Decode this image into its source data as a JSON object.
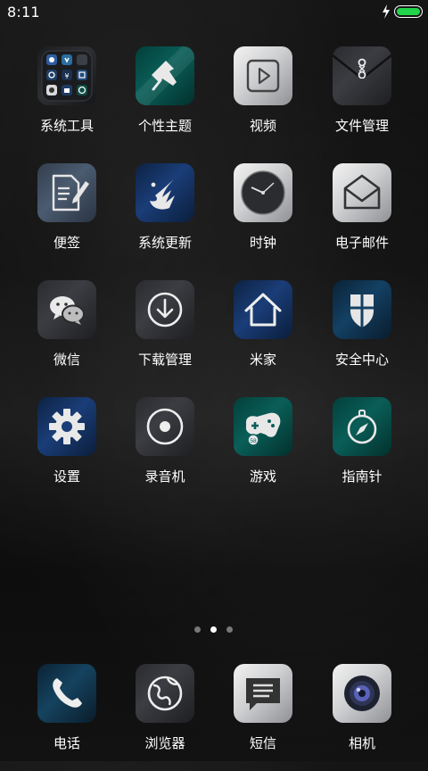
{
  "status_bar": {
    "time": "8:11",
    "battery_color": "#21d44b"
  },
  "apps": [
    {
      "label": "系统工具",
      "icon": "tools-folder-icon"
    },
    {
      "label": "个性主题",
      "icon": "theme-brush-icon"
    },
    {
      "label": "视频",
      "icon": "video-play-icon"
    },
    {
      "label": "文件管理",
      "icon": "file-manager-icon"
    },
    {
      "label": "便签",
      "icon": "notes-icon"
    },
    {
      "label": "系统更新",
      "icon": "system-update-icon"
    },
    {
      "label": "时钟",
      "icon": "clock-icon"
    },
    {
      "label": "电子邮件",
      "icon": "email-icon"
    },
    {
      "label": "微信",
      "icon": "wechat-icon"
    },
    {
      "label": "下载管理",
      "icon": "download-icon"
    },
    {
      "label": "米家",
      "icon": "home-icon"
    },
    {
      "label": "安全中心",
      "icon": "security-shield-icon"
    },
    {
      "label": "设置",
      "icon": "settings-gear-icon"
    },
    {
      "label": "录音机",
      "icon": "recorder-icon"
    },
    {
      "label": "游戏",
      "icon": "gamepad-icon"
    },
    {
      "label": "指南针",
      "icon": "compass-icon"
    }
  ],
  "page_indicator": {
    "pages": 3,
    "current": 2
  },
  "dock": [
    {
      "label": "电话",
      "icon": "phone-icon"
    },
    {
      "label": "浏览器",
      "icon": "browser-globe-icon"
    },
    {
      "label": "短信",
      "icon": "messages-icon"
    },
    {
      "label": "相机",
      "icon": "camera-icon"
    }
  ]
}
